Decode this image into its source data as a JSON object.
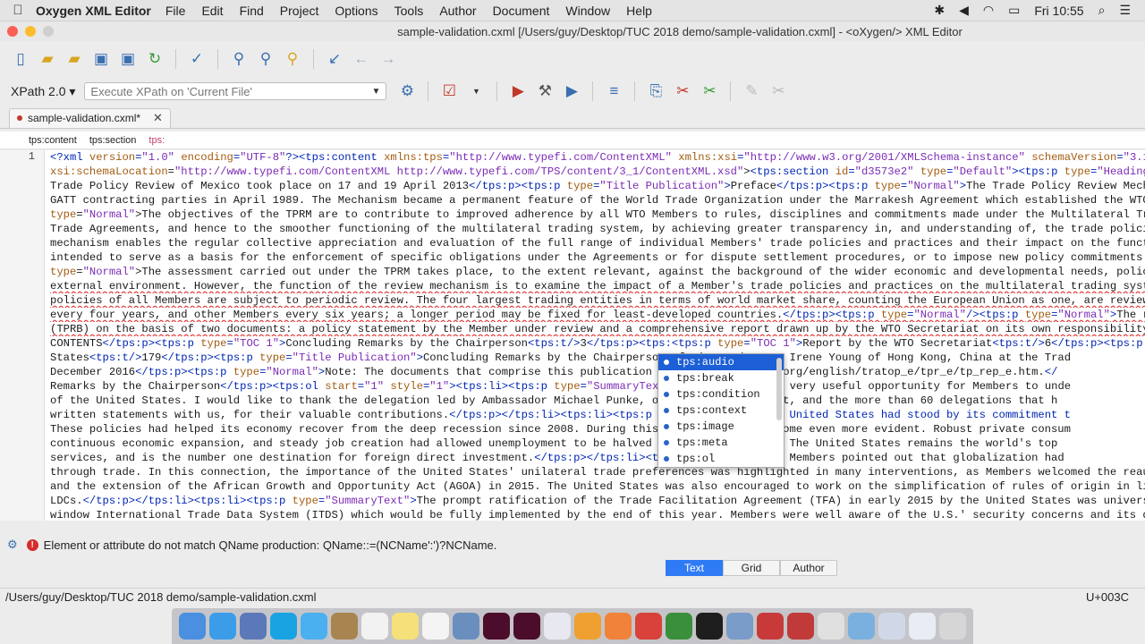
{
  "menubar": {
    "app": "Oxygen XML Editor",
    "items": [
      "File",
      "Edit",
      "Find",
      "Project",
      "Options",
      "Tools",
      "Author",
      "Document",
      "Window",
      "Help"
    ],
    "clock": "Fri 10:55"
  },
  "window": {
    "title": "sample-validation.cxml [/Users/guy/Desktop/TUC 2018 demo/sample-validation.cxml] - <oXygen/> XML Editor"
  },
  "xpath": {
    "label": "XPath 2.0",
    "placeholder": "Execute XPath on  'Current File'"
  },
  "tab": {
    "label": "sample-validation.cxml*"
  },
  "breadcrumb": [
    "tps:content",
    "tps:section",
    "tps:"
  ],
  "editor": {
    "line_number": "1",
    "lines": [
      "<?xml version=\"1.0\" encoding=\"UTF-8\"?><tps:content xmlns:tps=\"http://www.typefi.com/ContentXML\" xmlns:xsi=\"http://www.w3.org/2001/XMLSchema-instance\" schemaVersion=\"3.1\" white",
      "xsi:schemaLocation=\"http://www.typefi.com/ContentXML http://www.typefi.com/TPS/content/3_1/ContentXML.xsd\"><tps:section id=\"d3573e2\" type=\"Default\"><tps:p type=\"Heading 1\">A S",
      "Trade Policy Review of Mexico took place on 17 and 19 April 2013</tps:p><tps:p type=\"Title Publication\">Preface</tps:p><tps:p type=\"Normal\">The Trade Policy Review Mechanism (",
      "GATT contracting parties in April 1989. The Mechanism became a permanent feature of the World Trade Organization under the Marrakesh Agreement which established the WTO in Jan",
      "type=\"Normal\">The objectives of the TPRM are to contribute to improved adherence by all WTO Members to rules, disciplines and commitments made under the Multilateral Trade Agr",
      "Trade Agreements, and hence to the smoother functioning of the multilateral trading system, by achieving greater transparency in, and understanding of, the trade policies and",
      "mechanism enables the regular collective appreciation and evaluation of the full range of individual Members' trade policies and practices and their impact on the functioning",
      "intended to serve as a basis for the enforcement of specific obligations under the Agreements or for dispute settlement procedures, or to impose new policy commitments on Memb",
      "type=\"Normal\">The assessment carried out under the TPRM takes place, to the extent relevant, against the background of the wider economic and developmental needs, policies and",
      "external environment. However, the function of the review mechanism is to examine the impact of a Member's trade policies and practices on the multilateral trading system.</tp",
      "policies of all Members are subject to periodic review. The four largest trading entities in terms of world market share, counting the European Union as one, are reviewed ever",
      "every four years, and other Members every six years; a longer period may be fixed for least-developed countries.</tps:p><tps:p type=\"Normal\"/><tps:p type=\"Normal\">The reviews",
      "(TPRB) on the basis of two documents: a policy statement by the Member under review and a comprehensive report drawn up by the WTO Secretariat on its own responsibility.</tps:",
      "CONTENTS</tps:p><tps:p type=\"TOC 1\">Concluding Remarks by the Chairperson<tps:t/>3</tps:p><tps:<tps:p type=\"TOC 1\">Report by the WTO Secretariat<tps:t/>6</tps:p><tps:p type=\"T",
      "States<tps:t/>179</tps:p><tps:p type=\"Title Publication\">Concluding Remarks by the Chairperson of                   view Body, Ms. Irene Young of Hong Kong, China at the Trad",
      "December 2016</tps:p><tps:p type=\"Normal\">Note: The documents that comprise this publication are                   http://www.wto.org/english/tratop_e/tpr_e/tp_rep_e.htm.</",
      "Remarks by the Chairperson</tps:p><tps:ol start=\"1\" style=\"1\"><tps:li><tps:p type=\"SummaryText\">T                   iew has been a very useful opportunity for Members to unde",
      "of the United States. I would like to thank the delegation led by Ambassador Michael Punke, our d                  Daniel Blockert, and the more than 60 delegations that h",
      "written statements with us, for their valuable contributions.</tps:p></tps:li><tps:li><tps:p type                  any years, the United States had stood by its commitment t",
      "These policies had helped its economy recover from the deep recession since 2008. During this rev                  nefits had become even more evident. Robust private consum",
      "continuous economic expansion, and steady job creation had allowed unemployment to be halved sinc                  ancial crisis. The United States remains the world's top",
      "services, and is the number one destination for foreign direct investment.</tps:p></tps:li><tps:                  ryText\">Several Members pointed out that globalization had",
      "through trade. In this connection, the importance of the United States' unilateral trade preferences was highlighted in many interventions, as Members welcomed the reauthoriz",
      "and the extension of the African Growth and Opportunity Act (AGOA) in 2015. The United States was also encouraged to work on the simplification of rules of origin in line wit",
      "LDCs.</tps:p></tps:li><tps:li><tps:p type=\"SummaryText\">The prompt ratification of the Trade Facilitation Agreement (TFA) in early 2015 by the United States was universal we",
      "window International Trade Data System (ITDS) which would be fully implemented by the end of this year. Members were well aware of the U.S.' security concerns and its desire t"
    ]
  },
  "autocomplete": {
    "items": [
      "tps:audio",
      "tps:break",
      "tps:condition",
      "tps:context",
      "tps:image",
      "tps:meta",
      "tps:ol"
    ],
    "selected": 0
  },
  "problems": {
    "message": "Element or attribute do not match QName production: QName::=(NCName':')?NCName."
  },
  "modes": [
    "Text",
    "Grid",
    "Author"
  ],
  "status": {
    "path": "/Users/guy/Desktop/TUC 2018 demo/sample-validation.cxml",
    "codepoint": "U+003C"
  },
  "colors": {
    "tag": "#0026b3",
    "attr": "#a35c12",
    "value": "#7b2bb4",
    "selection": "#1c5fd6",
    "error": "#d92b2b",
    "mode_active": "#2f7bf5"
  }
}
